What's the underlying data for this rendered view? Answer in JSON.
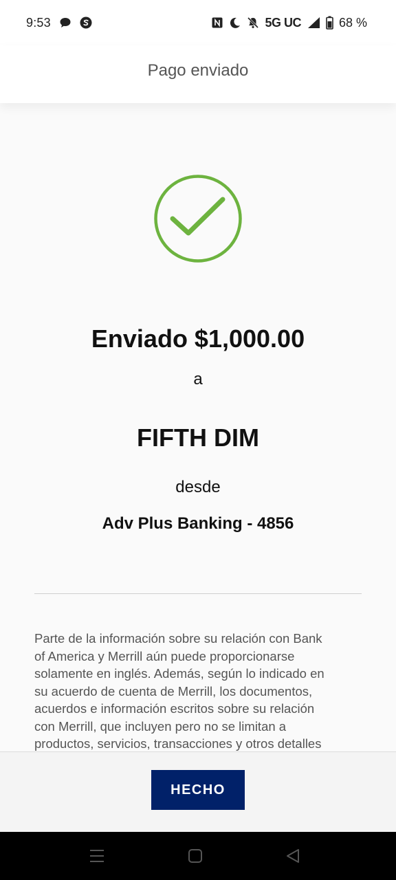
{
  "status_bar": {
    "time": "9:53",
    "network": "5G UC",
    "battery": "68 %",
    "icons": [
      "chat-bubble-icon",
      "app-s-icon",
      "nfc-icon",
      "moon-icon",
      "bell-off-icon",
      "signal-icon",
      "battery-icon"
    ]
  },
  "header": {
    "title": "Pago enviado"
  },
  "confirmation": {
    "status_icon": "check-circle-icon",
    "accent_color": "#6db33f",
    "amount_line": "Enviado $1,000.00",
    "to_word": "a",
    "recipient": "FIFTH DIM",
    "from_word": "desde",
    "account": "Adv Plus Banking - 4856"
  },
  "disclaimer": {
    "lines": [
      "Parte de la información sobre su relación con Bank",
      "of America y Merrill aún puede proporcionarse",
      "solamente en inglés. Además, según lo indicado en",
      "su acuerdo de cuenta de Merrill, los documentos,",
      "acuerdos e información escritos sobre su relación",
      "con Merrill, que incluyen pero no se limitan a",
      "productos, servicios, transacciones y otros detalles"
    ]
  },
  "footer": {
    "done_label": "HECHO",
    "button_color": "#012169"
  },
  "nav_bar": {
    "buttons": [
      "menu-icon",
      "home-icon",
      "back-icon"
    ]
  }
}
